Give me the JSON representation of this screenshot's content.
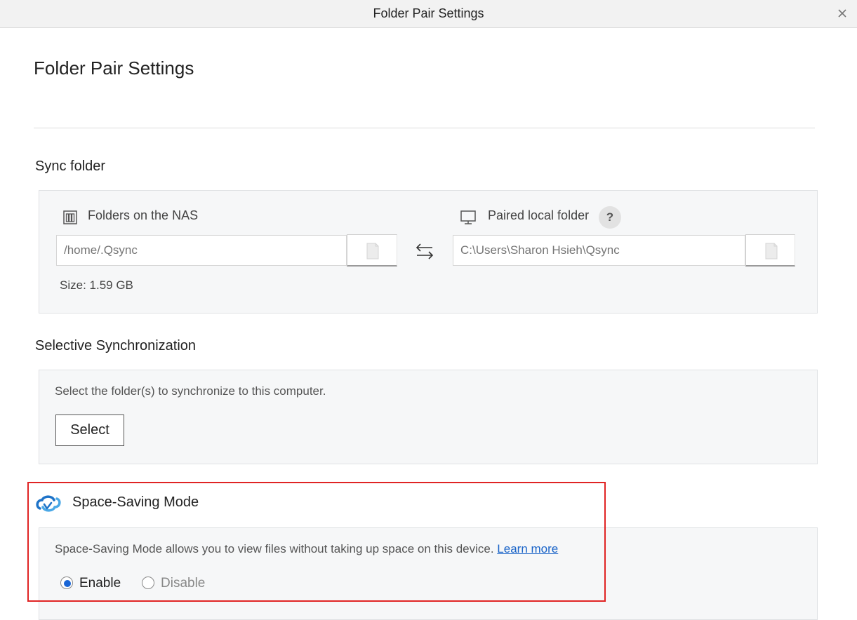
{
  "window": {
    "title": "Folder Pair Settings",
    "close_icon": "close-icon"
  },
  "page": {
    "heading": "Folder Pair Settings"
  },
  "sync_folder": {
    "title": "Sync folder",
    "nas": {
      "icon": "nas-icon",
      "label": "Folders on the NAS",
      "path_placeholder": "/home/.Qsync",
      "browse_icon": "folder-icon"
    },
    "swap_icon": "swap-arrows-icon",
    "local": {
      "icon": "monitor-icon",
      "label": "Paired local folder",
      "help_label": "?",
      "path_placeholder": "C:\\Users\\Sharon Hsieh\\Qsync",
      "browse_icon": "folder-icon"
    },
    "size_text": "Size: 1.59 GB"
  },
  "selective_sync": {
    "title": "Selective Synchronization",
    "description": "Select the folder(s) to synchronize to this computer.",
    "select_label": "Select"
  },
  "space_saving": {
    "icon": "qsync-cloud-icon",
    "title": "Space-Saving Mode",
    "description": "Space-Saving Mode allows you to view files without taking up space on this device. ",
    "learn_more": "Learn more",
    "options": [
      {
        "label": "Enable",
        "selected": true
      },
      {
        "label": "Disable",
        "selected": false
      }
    ]
  },
  "colors": {
    "accent": "#1a66d6",
    "link": "#1a64c8",
    "highlight_border": "#e02424",
    "panel_bg": "#f6f7f8"
  }
}
